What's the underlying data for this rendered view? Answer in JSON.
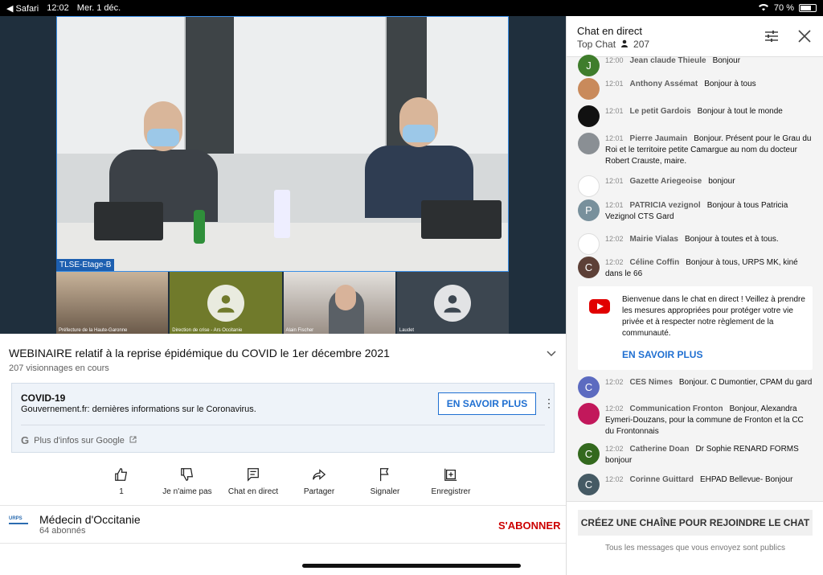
{
  "status_bar": {
    "back_app": "Safari",
    "time": "12:02",
    "date": "Mer. 1 déc.",
    "battery": "70 %",
    "battery_level": 0.7
  },
  "video": {
    "main_label": "TLSE-Etage-B",
    "thumbnails": [
      {
        "caption": "Préfecture de la Haute-Garonne"
      },
      {
        "caption": "Direction de crise - Ars Occitanie"
      },
      {
        "caption": "Alain Fischer"
      },
      {
        "caption": "Laudet"
      }
    ]
  },
  "info": {
    "title": "WEBINAIRE relatif à la reprise épidémique du COVID le 1er décembre 2021",
    "views": "207 visionnages en cours",
    "covid_card": {
      "heading": "COVID-19",
      "text": "Gouvernement.fr: dernières informations sur le Coronavirus.",
      "button": "EN SAVOIR PLUS",
      "google_link": "Plus d'infos sur Google"
    },
    "actions": [
      {
        "label": "1",
        "icon": "thumb-up-icon"
      },
      {
        "label": "Je n'aime pas",
        "icon": "thumb-down-icon"
      },
      {
        "label": "Chat en direct",
        "icon": "chat-icon"
      },
      {
        "label": "Partager",
        "icon": "share-icon"
      },
      {
        "label": "Signaler",
        "icon": "flag-icon"
      },
      {
        "label": "Enregistrer",
        "icon": "add-to-playlist-icon"
      }
    ],
    "channel": {
      "logo_text": "URPS",
      "name": "Médecin d'Occitanie",
      "subscribers": "64 abonnés",
      "subscribe": "S'ABONNER"
    }
  },
  "chat": {
    "title": "Chat en direct",
    "filter": "Top Chat",
    "viewers": "207",
    "messages": [
      {
        "time": "12:00",
        "author": "Jean claude Thieule",
        "text": "Bonjour",
        "initial": "J",
        "color": "#3f7d2c"
      },
      {
        "time": "12:01",
        "author": "Anthony Assémat",
        "text": "Bonjour à tous",
        "initial": "",
        "color": "#c98a5b"
      },
      {
        "time": "12:01",
        "author": "Le petit Gardois",
        "text": "Bonjour à tout le monde",
        "initial": "",
        "color": "#111111"
      },
      {
        "time": "12:01",
        "author": "Pierre Jaumain",
        "text": "Bonjour. Présent pour le Grau du Roi et le territoire petite Camargue au nom du docteur Robert Crauste, maire.",
        "initial": "",
        "color": "#8a8f94"
      },
      {
        "time": "12:01",
        "author": "Gazette Ariegeoise",
        "text": "bonjour",
        "initial": "",
        "color": "#ffffff"
      },
      {
        "time": "12:01",
        "author": "PATRICIA vezignol",
        "text": "Bonjour à tous Patricia Vezignol CTS Gard",
        "initial": "P",
        "color": "#78909c"
      },
      {
        "time": "12:02",
        "author": "Mairie Vialas",
        "text": "Bonjour à toutes et à tous.",
        "initial": "",
        "color": "#ffffff"
      },
      {
        "time": "12:02",
        "author": "Céline Coffin",
        "text": "Bonjour à tous, URPS MK, kiné dans le 66",
        "initial": "C",
        "color": "#5d4037"
      },
      {
        "time": "12:02",
        "author": "CES Nimes",
        "text": "Bonjour. C Dumontier, CPAM du gard",
        "initial": "C",
        "color": "#5c6bc0"
      },
      {
        "time": "12:02",
        "author": "Communication Fronton",
        "text": "Bonjour, Alexandra Eymeri-Douzans, pour la commune de Fronton et la CC du Frontonnais",
        "initial": "",
        "color": "#c2185b"
      },
      {
        "time": "12:02",
        "author": "Catherine Doan",
        "text": "Dr Sophie RENARD FORMS bonjour",
        "initial": "C",
        "color": "#33691e"
      },
      {
        "time": "12:02",
        "author": "Corinne Guittard",
        "text": "EHPAD Bellevue- Bonjour",
        "initial": "C",
        "color": "#455a64"
      }
    ],
    "notice": {
      "text": "Bienvenue dans le chat en direct ! Veillez à prendre les mesures appropriées pour protéger votre vie privée et à respecter notre règlement de la communauté.",
      "link": "EN SAVOIR PLUS"
    },
    "footer": {
      "button": "CRÉEZ UNE CHAÎNE POUR REJOINDRE LE CHAT",
      "note": "Tous les messages que vous envoyez sont publics"
    }
  }
}
